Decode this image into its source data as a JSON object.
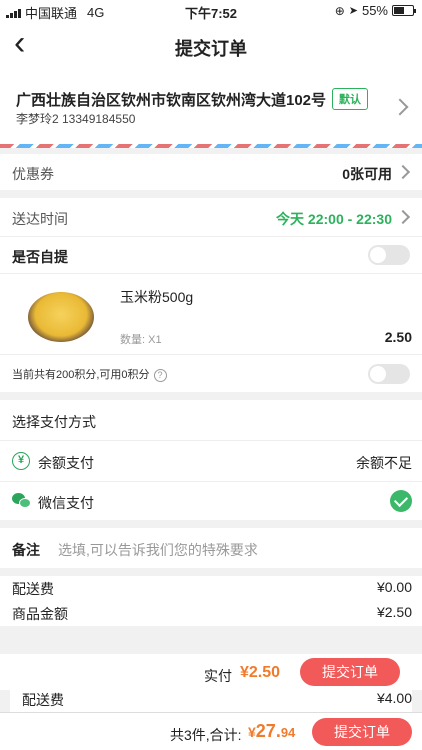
{
  "status_bar": {
    "carrier": "中国联通",
    "network": "4G",
    "time": "下午7:52",
    "battery": "55%"
  },
  "navbar": {
    "back_glyph": "‹",
    "title": "提交订单"
  },
  "address": {
    "text": "广西壮族自治区钦州市钦南区钦州湾大道102号",
    "badge": "默认",
    "contact": "李梦玲2 13349184550"
  },
  "coupon": {
    "label": "优惠券",
    "value": "0张可用"
  },
  "delivery": {
    "label": "送达时间",
    "value": "今天 22:00 - 22:30"
  },
  "self_pickup": {
    "label": "是否自提"
  },
  "product": {
    "name": "玉米粉500g",
    "quantity": "数量: X1",
    "price": "2.50"
  },
  "points": {
    "text": "当前共有200积分,可用0积分",
    "help": "?"
  },
  "payment": {
    "title": "选择支付方式",
    "balance": {
      "label": "余额支付",
      "status": "余额不足",
      "icon_glyph": "¥"
    },
    "wechat": {
      "label": "微信支付"
    }
  },
  "remark": {
    "label": "备注",
    "placeholder": "选填,可以告诉我们您的特殊要求"
  },
  "fees": {
    "delivery_label": "配送费",
    "delivery_value": "¥0.00",
    "goods_label": "商品金额",
    "goods_value": "¥2.50"
  },
  "actual": {
    "label": "实付",
    "value": "¥2.50",
    "button": "提交订单"
  },
  "overlay_fee": {
    "label": "配送费",
    "value": "¥4.00"
  },
  "footer": {
    "summary": "共3件,合计:",
    "currency": "¥",
    "total_main": "27.",
    "total_cents": "94",
    "button": "提交订单"
  },
  "colors": {
    "accent_green": "#2cb25c",
    "price_orange": "#f07b2b",
    "button_red": "#f25a5a"
  }
}
